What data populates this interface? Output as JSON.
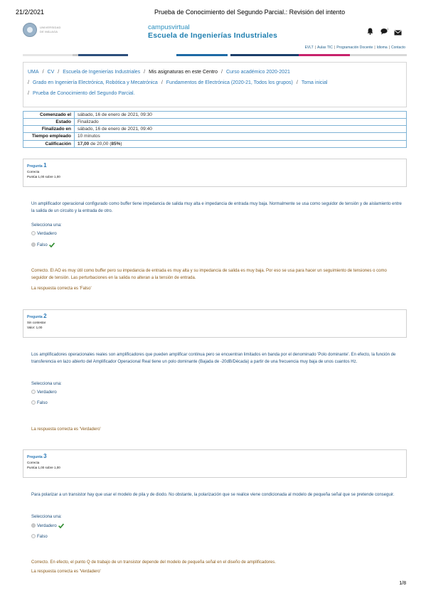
{
  "print_header": {
    "date": "21/2/2021",
    "title": "Prueba de Conocimiento del Segundo Parcial.: Revisión del intento"
  },
  "logo": {
    "text_line1": "UNIVERSIDAD",
    "text_line2": "DE MÁLAGA"
  },
  "brand": {
    "line1": "campusvirtual",
    "line2": "Escuela de Ingenierías Industriales"
  },
  "header_icons": [
    "bell-icon",
    "chat-icon",
    "mail-icon"
  ],
  "colors": {
    "link": "#2c79b6",
    "feedback": "#8a5a19",
    "correct": "#2e8b2e",
    "bar": [
      "#e6e6e6",
      "#c9c9c9",
      "#2c4f7c",
      "#1d6aa5",
      "#1b3f6b",
      "#c8226c",
      "#d9d9d9"
    ]
  },
  "top_links": [
    "EVLT",
    "Aulas TIC",
    "Programación Docente",
    "Idioma",
    "Contacto"
  ],
  "breadcrumb": {
    "line1": [
      "UMA",
      "CV",
      "Escuela de Ingenierías Industriales",
      "Mis asignaturas en este Centro",
      "Curso académico 2020-2021"
    ],
    "line2": [
      "Grado en Ingeniería Electrónica, Robótica y Mecatrónica",
      "Fundamentos de Electrónica (2020-21, Todos los grupos)",
      "Toma inicial"
    ],
    "line3": [
      "Prueba de Conocimiento del Segundo Parcial."
    ]
  },
  "summary": [
    {
      "label": "Comenzado el",
      "value": "sábado, 16 de enero de 2021, 09:30"
    },
    {
      "label": "Estado",
      "value": "Finalizado"
    },
    {
      "label": "Finalizado en",
      "value": "sábado, 16 de enero de 2021, 09:40"
    },
    {
      "label": "Tiempo empleado",
      "value": "10 minutos"
    },
    {
      "label": "Calificación",
      "value_bold": "17,00",
      "value_rest": " de 20,00 (",
      "value_pct": "85%",
      "value_end": ")"
    }
  ],
  "questions": [
    {
      "label": "Pregunta",
      "number": "1",
      "status": "Correcta",
      "score": "Puntúa 1,00 sobre 1,00",
      "text": "Un amplificador operacional configurado como buffer tiene impedancia de salida muy alta e impedancia de entrada muy baja. Normalmente se usa como seguidor de tensión y de aislamiento entre la salida de un circuito y la entrada de otro.",
      "prompt": "Selecciona una:",
      "options": [
        "Verdadero",
        "Falso"
      ],
      "feedback": "Correcto. El AO es muy útil como buffer pero su impedancia de entrada es muy alta y su impedancia de salida es muy baja. Por eso se usa para hacer un seguimiento de tensiones o como seguidor de tensión. Las perturbaciones en la salida no alteran a la tensión de entrada.",
      "answer": "La respuesta correcta es 'Falso'"
    },
    {
      "label": "Pregunta",
      "number": "2",
      "status": "Sin contestar",
      "score": "Valor: 1,00",
      "text": "Los amplificadores operacionales reales son amplificadores que pueden amplificar continua pero se encuentran limitados en banda por el denominado 'Polo dominante'. En efecto, la función de transferencia en lazo abierto del Amplificador Operacional  Real tiene un polo dominante (Bajada de -20dB/Década) a partir de una frecuencia muy baja de unos cuantos Hz.",
      "prompt": "Selecciona una:",
      "options": [
        "Verdadero",
        "Falso"
      ],
      "answer": "La respuesta correcta es 'Verdadero'"
    },
    {
      "label": "Pregunta",
      "number": "3",
      "status": "Correcta",
      "score": "Puntúa 1,00 sobre 1,00",
      "text": "Para polarizar a un transistor hay que usar el modelo de pila y de diodo. No obstante, la polarización que se realice viene condicionada al modelo de pequeña señal que se pretende conseguir.",
      "prompt": "Selecciona una:",
      "options": [
        "Verdadero",
        "Falso"
      ],
      "feedback": "Correcto. En efecto, el punto Q de trabajo de un transistor depende del modelo de pequeña señal en el diseño de amplificadores.",
      "answer": "La respuesta correcta es 'Verdadero'"
    }
  ],
  "page_number": "1/8"
}
